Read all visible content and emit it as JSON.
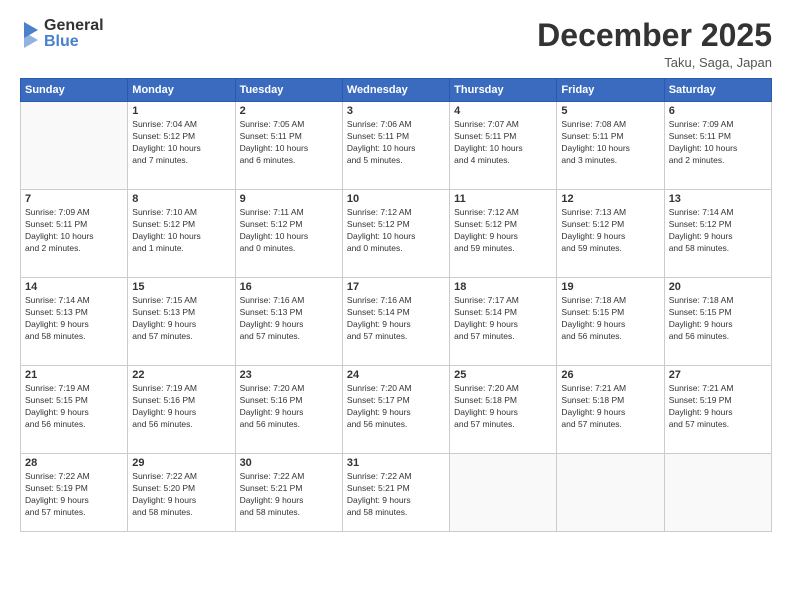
{
  "header": {
    "logo_general": "General",
    "logo_blue": "Blue",
    "month": "December 2025",
    "location": "Taku, Saga, Japan"
  },
  "weekdays": [
    "Sunday",
    "Monday",
    "Tuesday",
    "Wednesday",
    "Thursday",
    "Friday",
    "Saturday"
  ],
  "weeks": [
    [
      {
        "day": "",
        "info": ""
      },
      {
        "day": "1",
        "info": "Sunrise: 7:04 AM\nSunset: 5:12 PM\nDaylight: 10 hours\nand 7 minutes."
      },
      {
        "day": "2",
        "info": "Sunrise: 7:05 AM\nSunset: 5:11 PM\nDaylight: 10 hours\nand 6 minutes."
      },
      {
        "day": "3",
        "info": "Sunrise: 7:06 AM\nSunset: 5:11 PM\nDaylight: 10 hours\nand 5 minutes."
      },
      {
        "day": "4",
        "info": "Sunrise: 7:07 AM\nSunset: 5:11 PM\nDaylight: 10 hours\nand 4 minutes."
      },
      {
        "day": "5",
        "info": "Sunrise: 7:08 AM\nSunset: 5:11 PM\nDaylight: 10 hours\nand 3 minutes."
      },
      {
        "day": "6",
        "info": "Sunrise: 7:09 AM\nSunset: 5:11 PM\nDaylight: 10 hours\nand 2 minutes."
      }
    ],
    [
      {
        "day": "7",
        "info": "Sunrise: 7:09 AM\nSunset: 5:11 PM\nDaylight: 10 hours\nand 2 minutes."
      },
      {
        "day": "8",
        "info": "Sunrise: 7:10 AM\nSunset: 5:12 PM\nDaylight: 10 hours\nand 1 minute."
      },
      {
        "day": "9",
        "info": "Sunrise: 7:11 AM\nSunset: 5:12 PM\nDaylight: 10 hours\nand 0 minutes."
      },
      {
        "day": "10",
        "info": "Sunrise: 7:12 AM\nSunset: 5:12 PM\nDaylight: 10 hours\nand 0 minutes."
      },
      {
        "day": "11",
        "info": "Sunrise: 7:12 AM\nSunset: 5:12 PM\nDaylight: 9 hours\nand 59 minutes."
      },
      {
        "day": "12",
        "info": "Sunrise: 7:13 AM\nSunset: 5:12 PM\nDaylight: 9 hours\nand 59 minutes."
      },
      {
        "day": "13",
        "info": "Sunrise: 7:14 AM\nSunset: 5:12 PM\nDaylight: 9 hours\nand 58 minutes."
      }
    ],
    [
      {
        "day": "14",
        "info": "Sunrise: 7:14 AM\nSunset: 5:13 PM\nDaylight: 9 hours\nand 58 minutes."
      },
      {
        "day": "15",
        "info": "Sunrise: 7:15 AM\nSunset: 5:13 PM\nDaylight: 9 hours\nand 57 minutes."
      },
      {
        "day": "16",
        "info": "Sunrise: 7:16 AM\nSunset: 5:13 PM\nDaylight: 9 hours\nand 57 minutes."
      },
      {
        "day": "17",
        "info": "Sunrise: 7:16 AM\nSunset: 5:14 PM\nDaylight: 9 hours\nand 57 minutes."
      },
      {
        "day": "18",
        "info": "Sunrise: 7:17 AM\nSunset: 5:14 PM\nDaylight: 9 hours\nand 57 minutes."
      },
      {
        "day": "19",
        "info": "Sunrise: 7:18 AM\nSunset: 5:15 PM\nDaylight: 9 hours\nand 56 minutes."
      },
      {
        "day": "20",
        "info": "Sunrise: 7:18 AM\nSunset: 5:15 PM\nDaylight: 9 hours\nand 56 minutes."
      }
    ],
    [
      {
        "day": "21",
        "info": "Sunrise: 7:19 AM\nSunset: 5:15 PM\nDaylight: 9 hours\nand 56 minutes."
      },
      {
        "day": "22",
        "info": "Sunrise: 7:19 AM\nSunset: 5:16 PM\nDaylight: 9 hours\nand 56 minutes."
      },
      {
        "day": "23",
        "info": "Sunrise: 7:20 AM\nSunset: 5:16 PM\nDaylight: 9 hours\nand 56 minutes."
      },
      {
        "day": "24",
        "info": "Sunrise: 7:20 AM\nSunset: 5:17 PM\nDaylight: 9 hours\nand 56 minutes."
      },
      {
        "day": "25",
        "info": "Sunrise: 7:20 AM\nSunset: 5:18 PM\nDaylight: 9 hours\nand 57 minutes."
      },
      {
        "day": "26",
        "info": "Sunrise: 7:21 AM\nSunset: 5:18 PM\nDaylight: 9 hours\nand 57 minutes."
      },
      {
        "day": "27",
        "info": "Sunrise: 7:21 AM\nSunset: 5:19 PM\nDaylight: 9 hours\nand 57 minutes."
      }
    ],
    [
      {
        "day": "28",
        "info": "Sunrise: 7:22 AM\nSunset: 5:19 PM\nDaylight: 9 hours\nand 57 minutes."
      },
      {
        "day": "29",
        "info": "Sunrise: 7:22 AM\nSunset: 5:20 PM\nDaylight: 9 hours\nand 58 minutes."
      },
      {
        "day": "30",
        "info": "Sunrise: 7:22 AM\nSunset: 5:21 PM\nDaylight: 9 hours\nand 58 minutes."
      },
      {
        "day": "31",
        "info": "Sunrise: 7:22 AM\nSunset: 5:21 PM\nDaylight: 9 hours\nand 58 minutes."
      },
      {
        "day": "",
        "info": ""
      },
      {
        "day": "",
        "info": ""
      },
      {
        "day": "",
        "info": ""
      }
    ]
  ]
}
